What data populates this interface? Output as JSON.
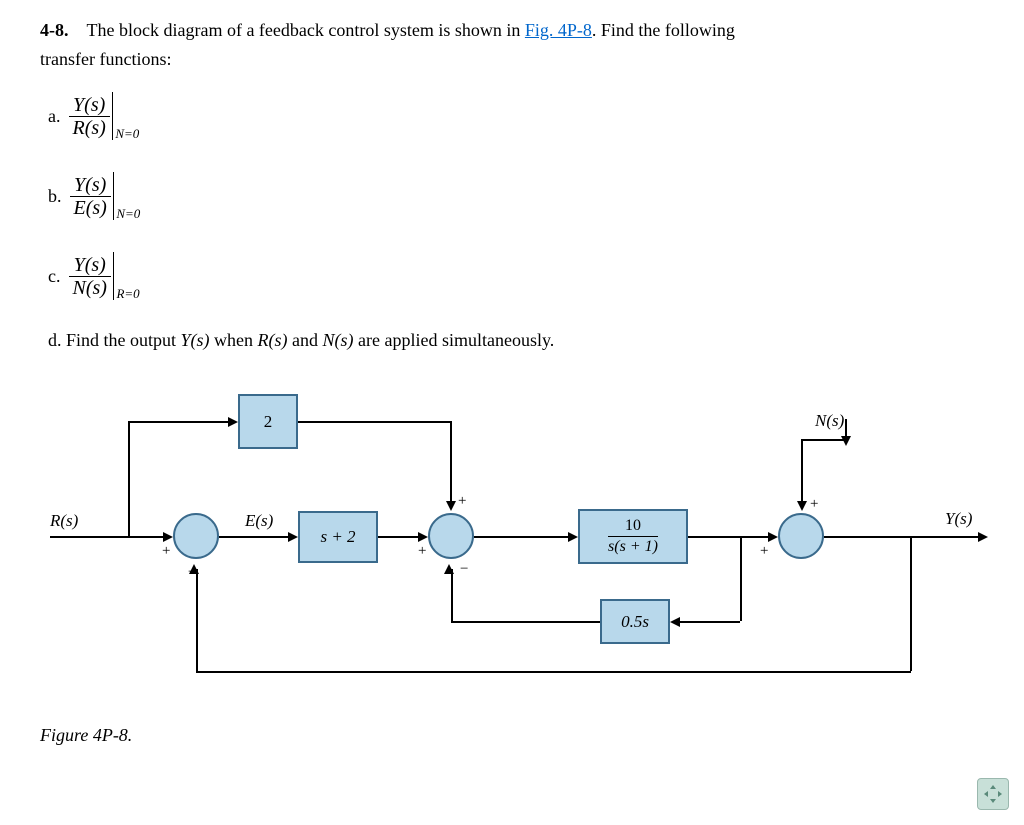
{
  "problem": {
    "number": "4-8.",
    "text_before_link": "The block diagram of a feedback control system is shown in ",
    "link_text": "Fig. 4P-8",
    "text_after_link": ". Find the following",
    "subtext": "transfer functions:"
  },
  "items": {
    "a": {
      "label": "a.",
      "num": "Y(s)",
      "den": "R(s)",
      "cond": "N=0"
    },
    "b": {
      "label": "b.",
      "num": "Y(s)",
      "den": "E(s)",
      "cond": "N=0"
    },
    "c": {
      "label": "c.",
      "num": "Y(s)",
      "den": "N(s)",
      "cond": "R=0"
    },
    "d": {
      "label": "d. Find the output ",
      "mid1": "Y(s)",
      "mid2": " when ",
      "mid3": "R(s)",
      "mid4": " and ",
      "mid5": "N(s)",
      "mid6": " are applied simultaneously."
    }
  },
  "diagram": {
    "input": "R(s)",
    "error": "E(s)",
    "disturbance": "N(s)",
    "output": "Y(s)",
    "block_feedforward": "2",
    "block_controller": "s + 2",
    "block_plant_num": "10",
    "block_plant_den": "s(s + 1)",
    "block_feedback": "0.5s",
    "signs": {
      "plus": "+",
      "minus": "−"
    }
  },
  "caption": "Figure 4P-8."
}
